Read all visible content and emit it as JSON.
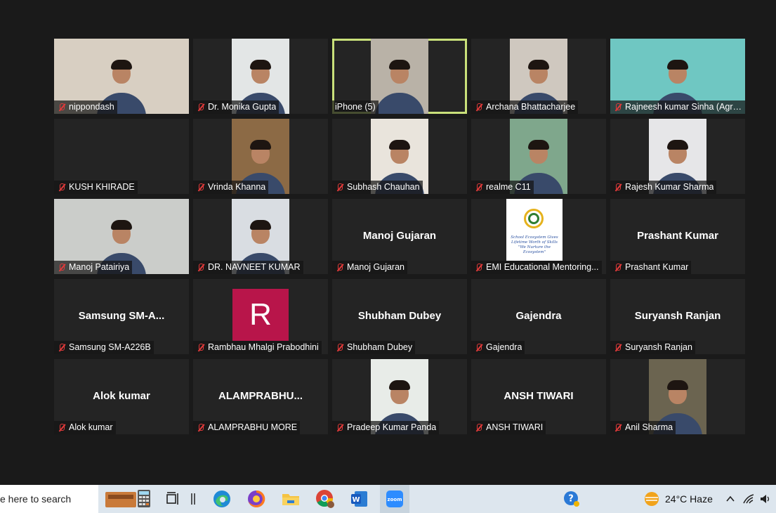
{
  "participants": [
    {
      "display": "nippondash",
      "big": "",
      "kind": "video",
      "bg": "#d8cfc2"
    },
    {
      "display": "Dr. Monika Gupta",
      "big": "",
      "kind": "video",
      "bg": "#e3e6e6"
    },
    {
      "display": "iPhone (5)",
      "big": "",
      "kind": "video",
      "bg": "#b9b2a7",
      "active": true,
      "muted": false
    },
    {
      "display": "Archana Bhattacharjee",
      "big": "",
      "kind": "video",
      "bg": "#cfc8bf"
    },
    {
      "display": "Rajneesh kumar Sinha (Agrani...",
      "big": "",
      "kind": "video",
      "bg": "#6fc7c2"
    },
    {
      "display": "KUSH KHIRADE",
      "big": "",
      "kind": "blank",
      "bg": "#242424"
    },
    {
      "display": "Vrinda Khanna",
      "big": "",
      "kind": "video",
      "bg": "#8c6a45"
    },
    {
      "display": "Subhash Chauhan",
      "big": "",
      "kind": "video",
      "bg": "#e9e4dc"
    },
    {
      "display": "realme C11",
      "big": "",
      "kind": "video",
      "bg": "#7fa78c"
    },
    {
      "display": "Rajesh Kumar Sharma",
      "big": "",
      "kind": "video",
      "bg": "#e6e6e8"
    },
    {
      "display": "Manoj Patairiya",
      "big": "",
      "kind": "video",
      "bg": "#cbcdca"
    },
    {
      "display": "DR. NAVNEET KUMAR",
      "big": "",
      "kind": "video",
      "bg": "#d9dde2"
    },
    {
      "display": "Manoj Gujaran",
      "big": "Manoj Gujaran",
      "kind": "name"
    },
    {
      "display": "EMI Educational Mentoring...",
      "big": "",
      "kind": "logo"
    },
    {
      "display": "Prashant Kumar",
      "big": "Prashant Kumar",
      "kind": "name"
    },
    {
      "display": "Samsung SM-A226B",
      "big": "Samsung  SM-A...",
      "kind": "name"
    },
    {
      "display": "Rambhau Mhalgi Prabodhini",
      "big": "",
      "kind": "avatar",
      "letter": "R"
    },
    {
      "display": "Shubham Dubey",
      "big": "Shubham Dubey",
      "kind": "name"
    },
    {
      "display": "Gajendra",
      "big": "Gajendra",
      "kind": "name"
    },
    {
      "display": "Suryansh Ranjan",
      "big": "Suryansh Ranjan",
      "kind": "name"
    },
    {
      "display": "Alok kumar",
      "big": "Alok kumar",
      "kind": "name"
    },
    {
      "display": "ALAMPRABHU MORE",
      "big": "ALAMPRABHU...",
      "kind": "name"
    },
    {
      "display": "Pradeep Kumar Panda",
      "big": "",
      "kind": "video",
      "bg": "#e8ece8"
    },
    {
      "display": "ANSH TIWARI",
      "big": "ANSH TIWARI",
      "kind": "name"
    },
    {
      "display": "Anil Sharma",
      "big": "",
      "kind": "video",
      "bg": "#6b6450"
    }
  ],
  "logo_text": "School Ecosystem Gives Lifetime Worth of Skills \"We Nurture the Ecosystem\"",
  "taskbar": {
    "search_text": "e here to search",
    "weather": "24°C  Haze"
  }
}
